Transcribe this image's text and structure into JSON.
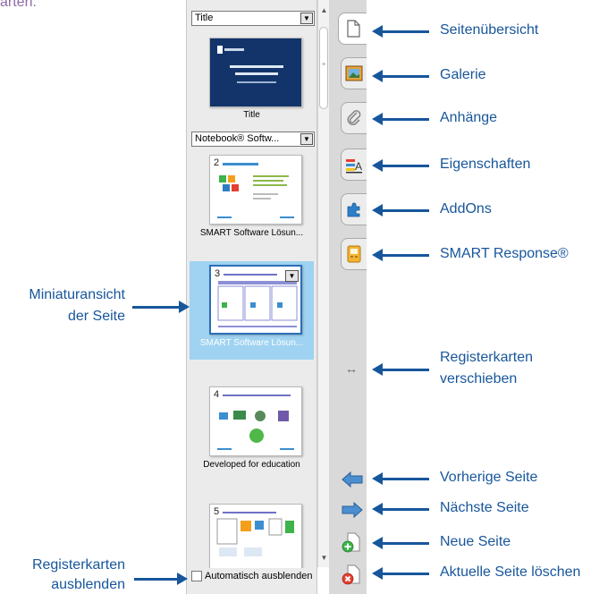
{
  "intro_text": "arten.",
  "sorter": {
    "dropdown_1": "Title",
    "page_1_label": "Title",
    "dropdown_2": "Notebook® Softw...",
    "page_2_number": "2",
    "page_2_label": "SMART Software Lösun...",
    "page_3_number": "3",
    "page_3_label": "SMART Software Lösun...",
    "page_4_number": "4",
    "page_4_label": "Developed for education",
    "page_5_number": "5",
    "autohide_label": "Automatisch ausblenden"
  },
  "callouts": {
    "seitenuebersicht": "Seitenübersicht",
    "galerie": "Galerie",
    "anhaenge": "Anhänge",
    "eigenschaften": "Eigenschaften",
    "addons": "AddOns",
    "smart_response": "SMART Response®",
    "registerkarten_verschieben_1": "Registerkarten",
    "registerkarten_verschieben_2": "verschieben",
    "vorherige_seite": "Vorherige Seite",
    "naechste_seite": "Nächste Seite",
    "neue_seite": "Neue Seite",
    "aktuelle_seite_loeschen": "Aktuelle Seite löschen",
    "miniaturansicht_1": "Miniaturansicht",
    "miniaturansicht_2": "der Seite",
    "registerkarten_ausblenden_1": "Registerkarten",
    "registerkarten_ausblenden_2": "ausblenden"
  },
  "colors": {
    "callout_blue": "#17569b",
    "selection_blue": "#9fd3f1",
    "intro_purple": "#8e6aa8"
  },
  "icons": [
    "page-sorter-icon",
    "gallery-icon",
    "paperclip-icon",
    "properties-icon",
    "addons-icon",
    "response-icon",
    "move-tabs-icon",
    "previous-page-icon",
    "next-page-icon",
    "new-page-icon",
    "delete-page-icon"
  ]
}
